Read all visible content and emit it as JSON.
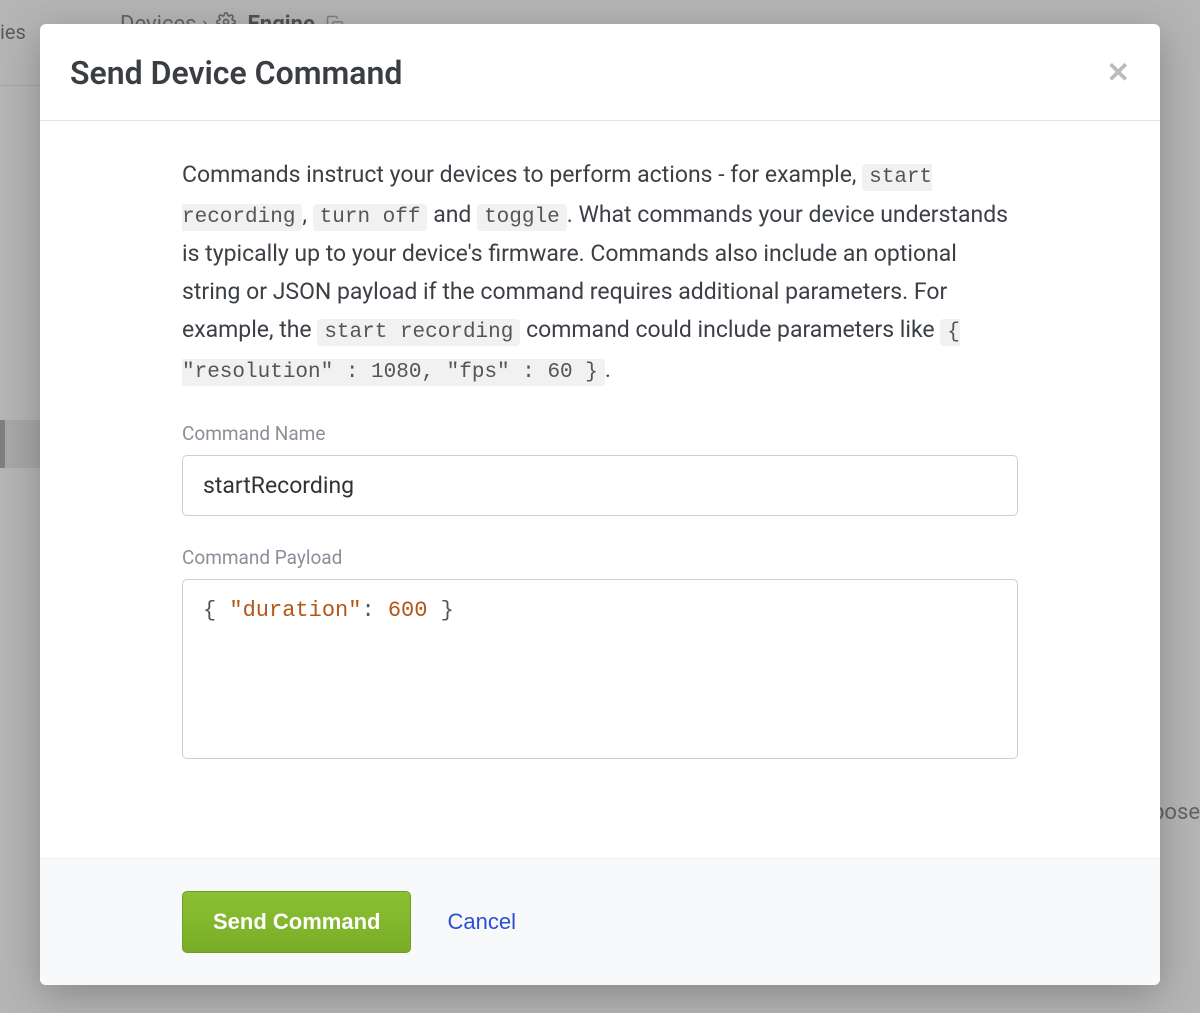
{
  "background": {
    "breadcrumb_root": "Devices",
    "breadcrumb_sep": "›",
    "breadcrumb_current": "Engine",
    "sidebar_fragment": "ies",
    "right_fragment": "pose"
  },
  "modal": {
    "title": "Send Device Command",
    "close_glyph": "✕",
    "description": {
      "part1": "Commands instruct your devices to perform actions - for example, ",
      "code1": "start recording",
      "sep1": ", ",
      "code2": "turn off",
      "sep2": " and ",
      "code3": "toggle",
      "part2": ". What commands your device understands is typically up to your device's firmware. Commands also include an optional string or JSON payload if the command requires additional parameters. For example, the ",
      "code4": "start recording",
      "part3": " command could include parameters like ",
      "code5": "{ \"resolution\" : 1080, \"fps\" : 60 }",
      "part4": "."
    },
    "form": {
      "name_label": "Command Name",
      "name_value": "startRecording",
      "payload_label": "Command Payload",
      "payload_tokens": {
        "lbrace": "{ ",
        "key": "\"duration\"",
        "colon": ": ",
        "num": "600",
        "rbrace": " }"
      }
    },
    "footer": {
      "send_label": "Send Command",
      "cancel_label": "Cancel"
    }
  }
}
